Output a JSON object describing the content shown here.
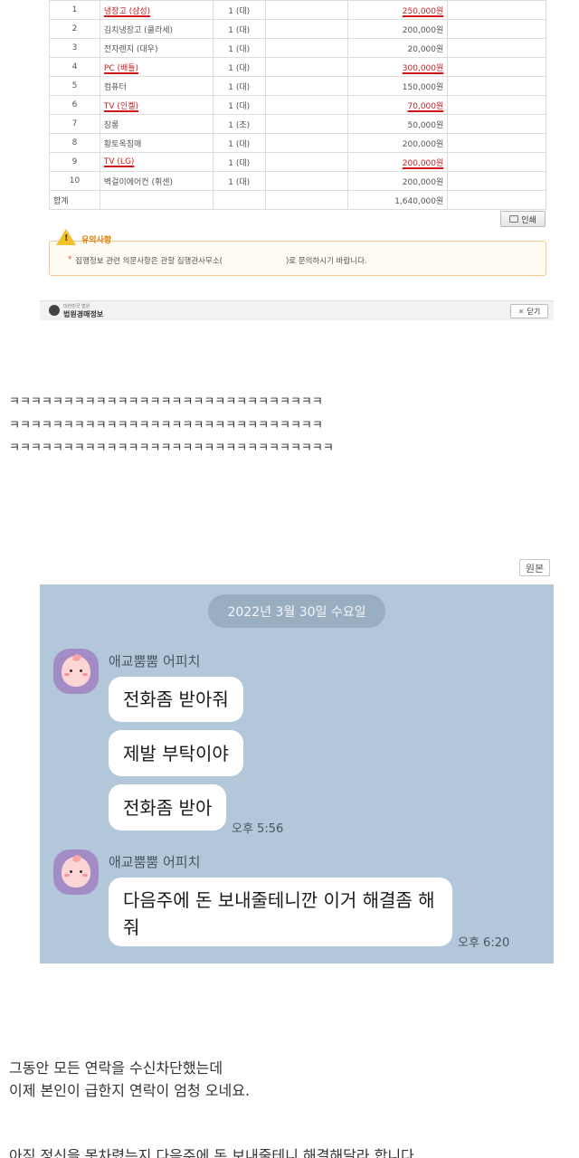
{
  "auction": {
    "rows": [
      {
        "no": "1",
        "name": "냉장고 (삼성)",
        "qty": "1 (대)",
        "price": "250,000원",
        "highlight": true
      },
      {
        "no": "2",
        "name": "김치냉장고 (클라세)",
        "qty": "1 (대)",
        "price": "200,000원",
        "highlight": false
      },
      {
        "no": "3",
        "name": "전자렌지 (대우)",
        "qty": "1 (대)",
        "price": "20,000원",
        "highlight": false
      },
      {
        "no": "4",
        "name": "PC (배틀)",
        "qty": "1 (대)",
        "price": "300,000원",
        "highlight": true
      },
      {
        "no": "5",
        "name": "컴퓨터",
        "qty": "1 (대)",
        "price": "150,000원",
        "highlight": false
      },
      {
        "no": "6",
        "name": "TV (인켈)",
        "qty": "1 (대)",
        "price": "70,000원",
        "highlight": true
      },
      {
        "no": "7",
        "name": "장롱",
        "qty": "1 (조)",
        "price": "50,000원",
        "highlight": false
      },
      {
        "no": "8",
        "name": "황토옥침매",
        "qty": "1 (대)",
        "price": "200,000원",
        "highlight": false
      },
      {
        "no": "9",
        "name": "TV (LG)",
        "qty": "1 (대)",
        "price": "200,000원",
        "highlight": true
      },
      {
        "no": "10",
        "name": "벽걸이에어컨 (휘센)",
        "qty": "1 (대)",
        "price": "200,000원",
        "highlight": false
      }
    ],
    "total_label": "합계",
    "total_value": "1,640,000원",
    "print_label": "인쇄",
    "notice_title": "유의사항",
    "notice_text_before": "집행정보 관련 의문사항은 관할 집행관사무소(",
    "notice_text_after": ")로 문의하시기 바랍니다.",
    "footer_small": "대한민국 법원",
    "footer_name": "법원경매정보",
    "close_label": "닫기"
  },
  "laugh_lines": [
    "ㅋㅋㅋㅋㅋㅋㅋㅋㅋㅋㅋㅋㅋㅋㅋㅋㅋㅋㅋㅋㅋㅋㅋㅋㅋㅋㅋㅋㅋ",
    "ㅋㅋㅋㅋㅋㅋㅋㅋㅋㅋㅋㅋㅋㅋㅋㅋㅋㅋㅋㅋㅋㅋㅋㅋㅋㅋㅋㅋㅋ",
    "ㅋㅋㅋㅋㅋㅋㅋㅋㅋㅋㅋㅋㅋㅋㅋㅋㅋㅋㅋㅋㅋㅋㅋㅋㅋㅋㅋㅋㅋㅋ"
  ],
  "original_button": "원본",
  "chat": {
    "date": "2022년 3월 30일 수요일",
    "groups": [
      {
        "sender": "애교뿜뿜 어피치",
        "messages": [
          "전화좀 받아줘",
          "제발 부탁이야",
          "전화좀 받아"
        ],
        "time": "오후 5:56"
      },
      {
        "sender": "애교뿜뿜 어피치",
        "messages": [
          "다음주에 돈 보내줄테니깐 이거 해결좀 해",
          "줘"
        ],
        "time": "오후 6:20"
      }
    ],
    "colors": {
      "background": "#b2c7da",
      "bubble": "#ffffff",
      "avatar": "#a38cc6"
    }
  },
  "body_text": [
    "그동안 모든 연락을 수신차단했는데",
    "이제 본인이 급한지 연락이 엄청 오네요.",
    "아직 정신을 못차렸는지 다음주에 돈 보내줄테니 해결해달라 합니다."
  ],
  "icons": {
    "warning": "warning-triangle-icon",
    "print": "printer-icon",
    "close": "close-x-icon",
    "logo": "court-logo-icon"
  }
}
